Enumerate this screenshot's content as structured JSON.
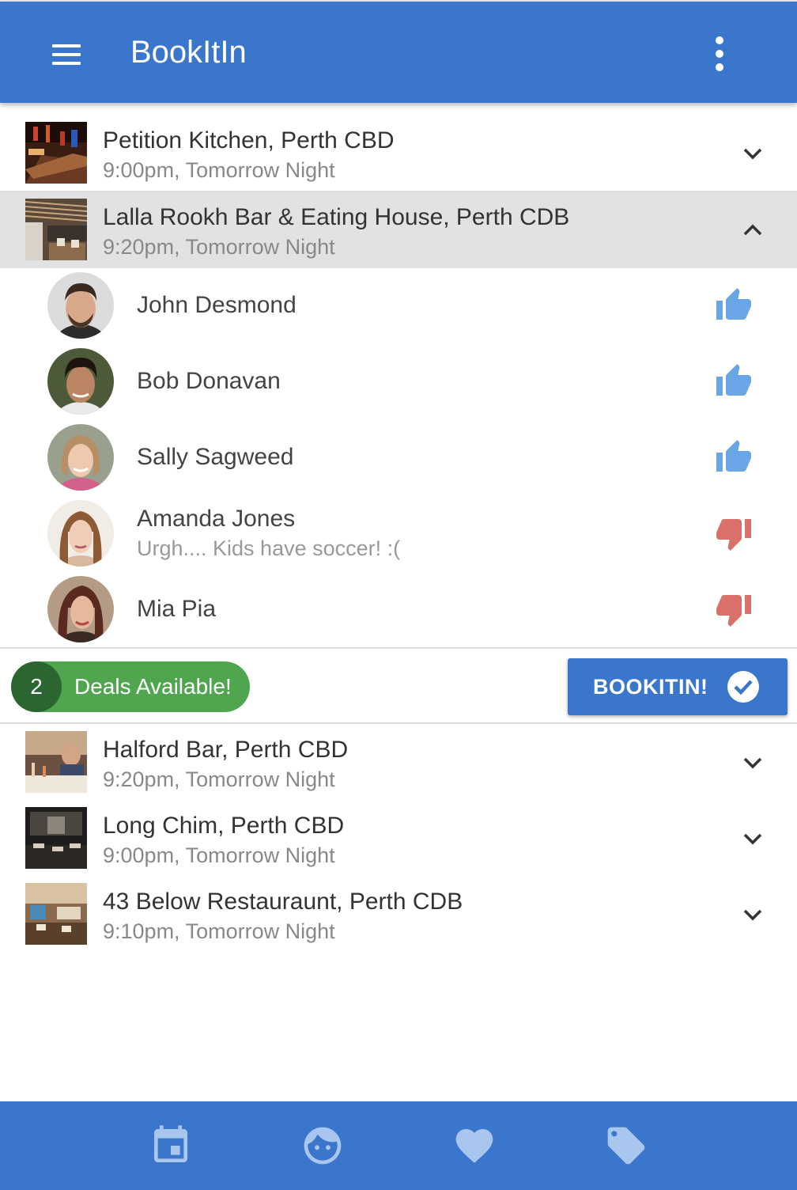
{
  "app": {
    "title": "BookItIn"
  },
  "venues_top": [
    {
      "name": "Petition Kitchen, Perth CBD",
      "time": "9:00pm, Tomorrow Night",
      "expanded": false
    },
    {
      "name": "Lalla Rookh Bar & Eating House, Perth CDB",
      "time": "9:20pm, Tomorrow Night",
      "expanded": true
    }
  ],
  "attendees": [
    {
      "name": "John Desmond",
      "note": "",
      "vote": "thumbs-up-icon"
    },
    {
      "name": "Bob Donavan",
      "note": "",
      "vote": "thumbs-up-icon"
    },
    {
      "name": "Sally Sagweed",
      "note": "",
      "vote": "thumbs-up-icon"
    },
    {
      "name": "Amanda Jones",
      "note": "Urgh.... Kids have soccer! :(",
      "vote": "thumbs-down-icon"
    },
    {
      "name": "Mia Pia",
      "note": "",
      "vote": "thumbs-down-icon"
    }
  ],
  "actions": {
    "deals_count": "2",
    "deals_label": "Deals Available!",
    "bookit_label": "BOOKITIN!"
  },
  "venues_bottom": [
    {
      "name": "Halford Bar, Perth CBD",
      "time": "9:20pm, Tomorrow Night",
      "expanded": false
    },
    {
      "name": "Long Chim, Perth CBD",
      "time": "9:00pm, Tomorrow Night",
      "expanded": false
    },
    {
      "name": "43 Below Restauraunt, Perth CDB",
      "time": "9:10pm, Tomorrow Night",
      "expanded": false
    }
  ],
  "bottom_nav": [
    "calendar-icon",
    "face-icon",
    "heart-icon",
    "tag-icon"
  ],
  "colors": {
    "primary": "#3a76cb",
    "thumbs_up": "#6aa5e6",
    "thumbs_down": "#d9706a",
    "deals_green": "#4fa64f",
    "deals_dark_green": "#2b6530",
    "expanded_row": "#e2e2e2"
  }
}
